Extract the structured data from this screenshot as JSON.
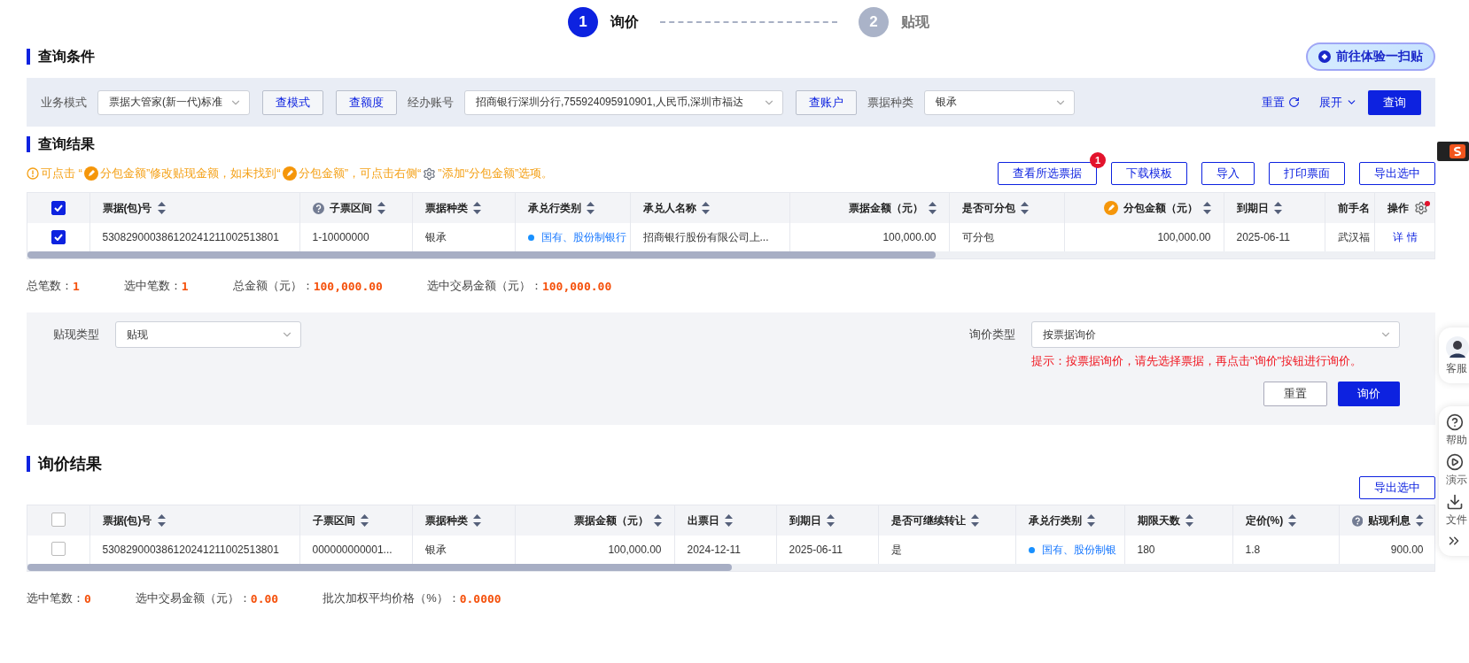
{
  "steps": [
    {
      "number": "1",
      "label": "询价",
      "selected": true
    },
    {
      "number": "2",
      "label": "贴现",
      "selected": false
    }
  ],
  "query": {
    "title": "查询条件",
    "promo_button": "前往体验一扫贴",
    "fields": [
      {
        "kind": "select",
        "label": "业务模式",
        "value": "票据大管家(新一代)标准"
      },
      {
        "kind": "button",
        "label": "查模式"
      },
      {
        "kind": "button",
        "label": "查额度"
      },
      {
        "kind": "select",
        "label": "经办账号",
        "value": "招商银行深圳分行,755924095910901,人民币,深圳市福达"
      },
      {
        "kind": "button",
        "label": "查账户"
      },
      {
        "kind": "select",
        "label": "票据种类",
        "value": "银承"
      }
    ],
    "reset": "重置",
    "expand": "展开",
    "search": "查询"
  },
  "results": {
    "title": "查询结果",
    "hint": [
      {
        "kind": "warn"
      },
      {
        "kind": "text",
        "text": "可点击 “"
      },
      {
        "kind": "edit"
      },
      {
        "kind": "text",
        "text": "分包金额”修改贴现金额，如未找到“"
      },
      {
        "kind": "edit"
      },
      {
        "kind": "text",
        "text": "分包金额”，可点击右侧“"
      },
      {
        "kind": "gear"
      },
      {
        "kind": "text",
        "text": "”添加“分包金额”选项。"
      }
    ],
    "buttons": [
      {
        "label": "查看所选票据",
        "badge": "1"
      },
      {
        "label": "下载模板"
      },
      {
        "label": "导入"
      },
      {
        "label": "打印票面"
      },
      {
        "label": "导出选中"
      }
    ],
    "table": {
      "all_checked": true,
      "columns": [
        {
          "label": "票据(包)号",
          "kind": "text"
        },
        {
          "label": "子票区间",
          "kind": "info"
        },
        {
          "label": "票据种类",
          "kind": "text"
        },
        {
          "label": "承兑行类别",
          "kind": "bank"
        },
        {
          "label": "承兑人名称",
          "kind": "text"
        },
        {
          "label": "票据金额（元）",
          "kind": "amount"
        },
        {
          "label": "是否可分包",
          "kind": "text"
        },
        {
          "label": "分包金额（元）",
          "kind": "editable"
        },
        {
          "label": "到期日",
          "kind": "text"
        },
        {
          "label": "前手名",
          "kind": "cut"
        },
        {
          "label": "操作",
          "kind": "action"
        }
      ],
      "rows": [
        {
          "checked": true,
          "cells": [
            "530829000386120241211002513801",
            "1-10000000",
            "银承",
            "国有、股份制银行",
            "招商银行股份有限公司上...",
            "100,000.00",
            "可分包",
            "100,000.00",
            "2025-06-11",
            "武汉福",
            "详 情"
          ]
        }
      ]
    },
    "summary": [
      {
        "label": "总笔数：",
        "value": "1"
      },
      {
        "label": "选中笔数：",
        "value": "1"
      },
      {
        "label": "总金额（元）：",
        "value": "100,000.00"
      },
      {
        "label": "选中交易金额（元）：",
        "value": "100,000.00"
      }
    ]
  },
  "form": {
    "discount_type": {
      "label": "贴现类型",
      "value": "贴现"
    },
    "inquiry_type": {
      "label": "询价类型",
      "value": "按票据询价"
    },
    "tip": "提示：按票据询价，请先选择票据，再点击\"询价\"按钮进行询价。",
    "reset": "重置",
    "submit": "询价"
  },
  "inquiry": {
    "title": "询价结果",
    "export": "导出选中",
    "table": {
      "all_checked": false,
      "columns": [
        {
          "label": "票据(包)号",
          "kind": "text"
        },
        {
          "label": "子票区间",
          "kind": "text"
        },
        {
          "label": "票据种类",
          "kind": "text"
        },
        {
          "label": "票据金额（元）",
          "kind": "amount"
        },
        {
          "label": "出票日",
          "kind": "text"
        },
        {
          "label": "到期日",
          "kind": "text"
        },
        {
          "label": "是否可继续转让",
          "kind": "text"
        },
        {
          "label": "承兑行类别",
          "kind": "bank"
        },
        {
          "label": "期限天数",
          "kind": "text"
        },
        {
          "label": "定价(%)",
          "kind": "text"
        },
        {
          "label": "贴现利息",
          "kind": "info_amount"
        }
      ],
      "rows": [
        {
          "checked": false,
          "cells": [
            "530829000386120241211002513801",
            "000000000001...",
            "银承",
            "100,000.00",
            "2024-12-11",
            "2025-06-11",
            "是",
            "国有、股份制银",
            "180",
            "1.8",
            "900.00"
          ]
        }
      ]
    },
    "summary": [
      {
        "label": "选中笔数：",
        "value": "0"
      },
      {
        "label": "选中交易金额（元）：",
        "value": "0.00"
      },
      {
        "label": "批次加权平均价格（%）：",
        "value": "0.0000"
      }
    ]
  },
  "side": [
    {
      "kind": "avatar",
      "label": "客服"
    },
    {
      "kind": "help",
      "label": "帮助"
    },
    {
      "kind": "play",
      "label": "演示"
    },
    {
      "kind": "download",
      "label": "文件"
    },
    {
      "kind": "more"
    }
  ]
}
